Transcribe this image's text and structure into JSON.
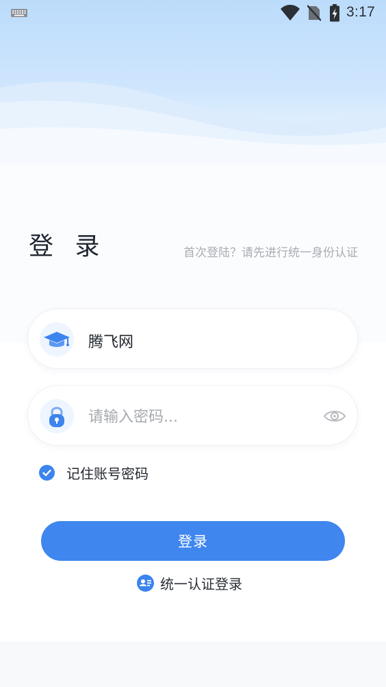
{
  "status_bar": {
    "time": "3:17",
    "icons": [
      "keyboard-icon",
      "wifi-icon",
      "no-sim-icon",
      "battery-charging-icon"
    ]
  },
  "login": {
    "title": "登 录",
    "first_login_hint": "首次登陆？请先进行统一身份认证",
    "school": {
      "icon": "graduation-cap-icon",
      "value": "腾飞网"
    },
    "password": {
      "icon": "lock-icon",
      "placeholder": "请输入密码...",
      "toggle_icon": "eye-icon"
    },
    "remember": {
      "label": "记住账号密码",
      "checked": true
    },
    "submit_label": "登录",
    "unified_login": {
      "icon": "id-card-icon",
      "label": "统一认证登录"
    }
  },
  "colors": {
    "accent": "#3f86ee",
    "header_top": "#bcdcfb",
    "text_primary": "#22262d",
    "text_hint": "#a9acb2"
  }
}
